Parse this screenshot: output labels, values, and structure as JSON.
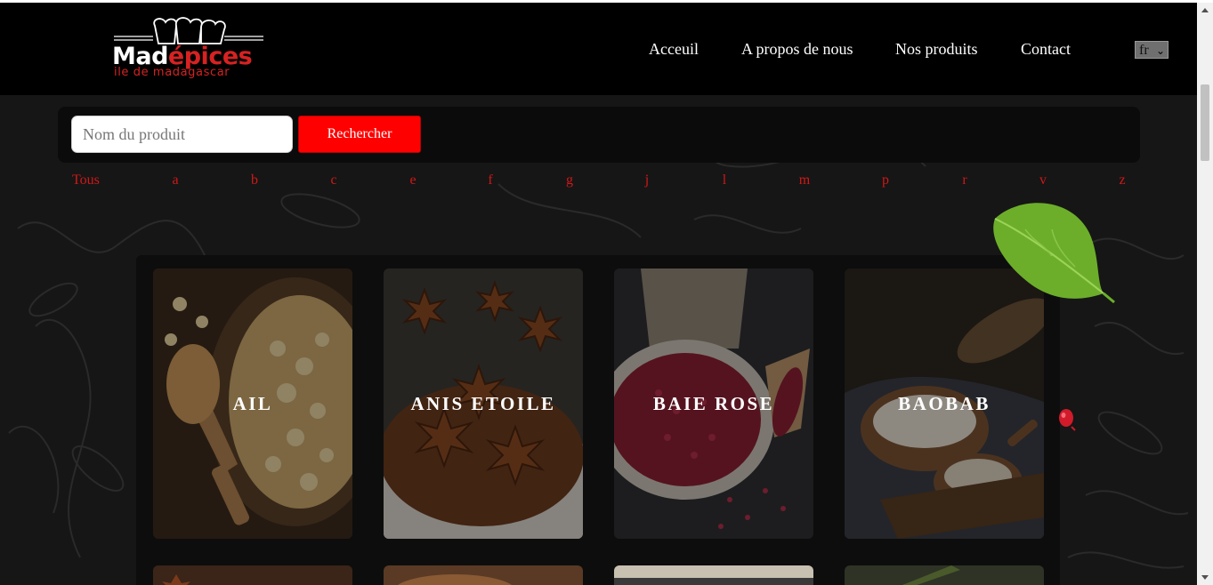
{
  "header": {
    "logo": {
      "word_white": "Mad",
      "word_red": "épices",
      "subtitle": "ile de madagascar"
    },
    "nav": [
      {
        "label": "Acceuil"
      },
      {
        "label": "A propos de nous"
      },
      {
        "label": "Nos produits"
      },
      {
        "label": "Contact"
      }
    ],
    "language": {
      "value": "fr",
      "options": [
        "fr"
      ]
    }
  },
  "search": {
    "placeholder": "Nom du produit",
    "value": "",
    "button_label": "Rechercher"
  },
  "letter_filter": [
    "Tous",
    "a",
    "b",
    "c",
    "e",
    "f",
    "g",
    "j",
    "l",
    "m",
    "p",
    "r",
    "v",
    "z"
  ],
  "products": [
    {
      "name": "AIL",
      "image": "dried-garlic-flakes-image"
    },
    {
      "name": "ANIS ETOILE",
      "image": "star-anise-image"
    },
    {
      "name": "BAIE ROSE",
      "image": "pink-peppercorn-image"
    },
    {
      "name": "BAOBAB",
      "image": "baobab-powder-image"
    }
  ],
  "colors": {
    "accent_red": "#ff0000",
    "link_red": "#d01818",
    "header_bg": "#000000",
    "page_bg": "#161616"
  }
}
